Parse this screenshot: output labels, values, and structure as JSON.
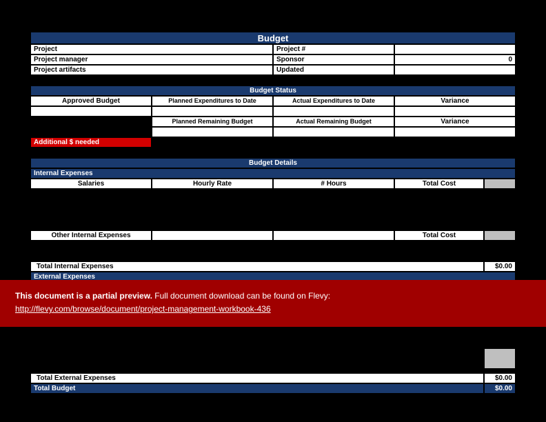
{
  "title": "Budget",
  "meta": {
    "project_label": "Project",
    "project_num_label": "Project #",
    "pm_label": "Project manager",
    "sponsor_label": "Sponsor",
    "sponsor_value": "0",
    "artifacts_label": "Project artifacts",
    "updated_label": "Updated"
  },
  "status": {
    "header": "Budget Status",
    "approved": "Approved Budget",
    "planned_exp": "Planned Expenditures to Date",
    "actual_exp": "Actual Expenditures to Date",
    "variance": "Variance",
    "planned_remain": "Planned Remaining Budget",
    "actual_remain": "Actual Remaining Budget",
    "additional": "Additional $ needed"
  },
  "details": {
    "header": "Budget Details",
    "internal": "Internal Expenses",
    "salaries": "Salaries",
    "hourly": "Hourly Rate",
    "hours": "# Hours",
    "total_cost": "Total Cost",
    "other_internal": "Other Internal Expenses",
    "total_internal": "Total Internal Expenses",
    "total_internal_val": "$0.00",
    "external": "External Expenses",
    "total_external": "Total External Expenses",
    "total_external_val": "$0.00",
    "total_budget": "Total Budget",
    "total_budget_val": "$0.00"
  },
  "overlay": {
    "bold": "This document is a partial preview.",
    "rest": "  Full document download can be found on Flevy:",
    "link": "http://flevy.com/browse/document/project-management-workbook-436"
  }
}
